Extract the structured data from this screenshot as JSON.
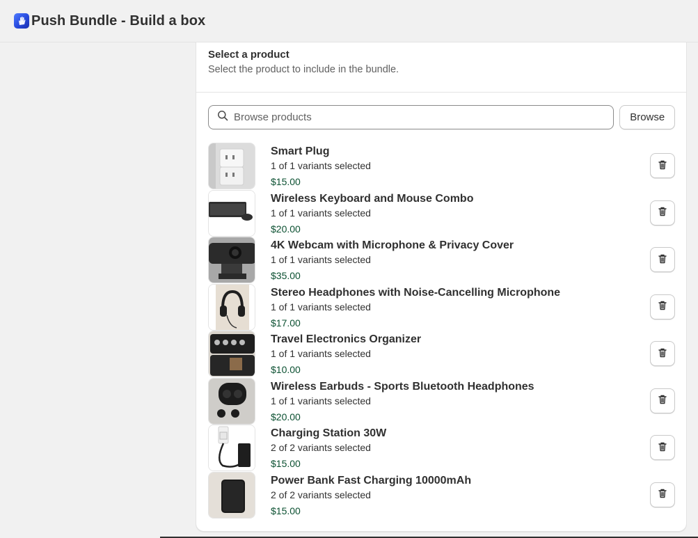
{
  "app": {
    "title": "Push Bundle - Build a box",
    "logo_icon": "hand-logo-icon",
    "brand_color": "#2a4de0"
  },
  "section": {
    "title": "Select a product",
    "subtitle": "Select the product to include in the bundle."
  },
  "search": {
    "placeholder": "Browse products",
    "value": "",
    "browse_label": "Browse"
  },
  "colors": {
    "price": "#0c5132",
    "text": "#303030"
  },
  "products": [
    {
      "name": "Smart Plug",
      "variants": "1 of 1 variants selected",
      "price": "$15.00",
      "image": "smart-plug"
    },
    {
      "name": "Wireless Keyboard and Mouse Combo",
      "variants": "1 of 1 variants selected",
      "price": "$20.00",
      "image": "keyboard-mouse"
    },
    {
      "name": "4K Webcam with Microphone & Privacy Cover",
      "variants": "1 of 1 variants selected",
      "price": "$35.00",
      "image": "webcam"
    },
    {
      "name": "Stereo Headphones with Noise-Cancelling Microphone",
      "variants": "1 of 1 variants selected",
      "price": "$17.00",
      "image": "headphones"
    },
    {
      "name": "Travel Electronics Organizer",
      "variants": "1 of 1 variants selected",
      "price": "$10.00",
      "image": "organizer"
    },
    {
      "name": "Wireless Earbuds - Sports Bluetooth Headphones",
      "variants": "1 of 1 variants selected",
      "price": "$20.00",
      "image": "earbuds"
    },
    {
      "name": "Charging Station 30W",
      "variants": "2 of 2 variants selected",
      "price": "$15.00",
      "image": "charging-station"
    },
    {
      "name": "Power Bank Fast Charging 10000mAh",
      "variants": "2 of 2 variants selected",
      "price": "$15.00",
      "image": "power-bank"
    }
  ]
}
